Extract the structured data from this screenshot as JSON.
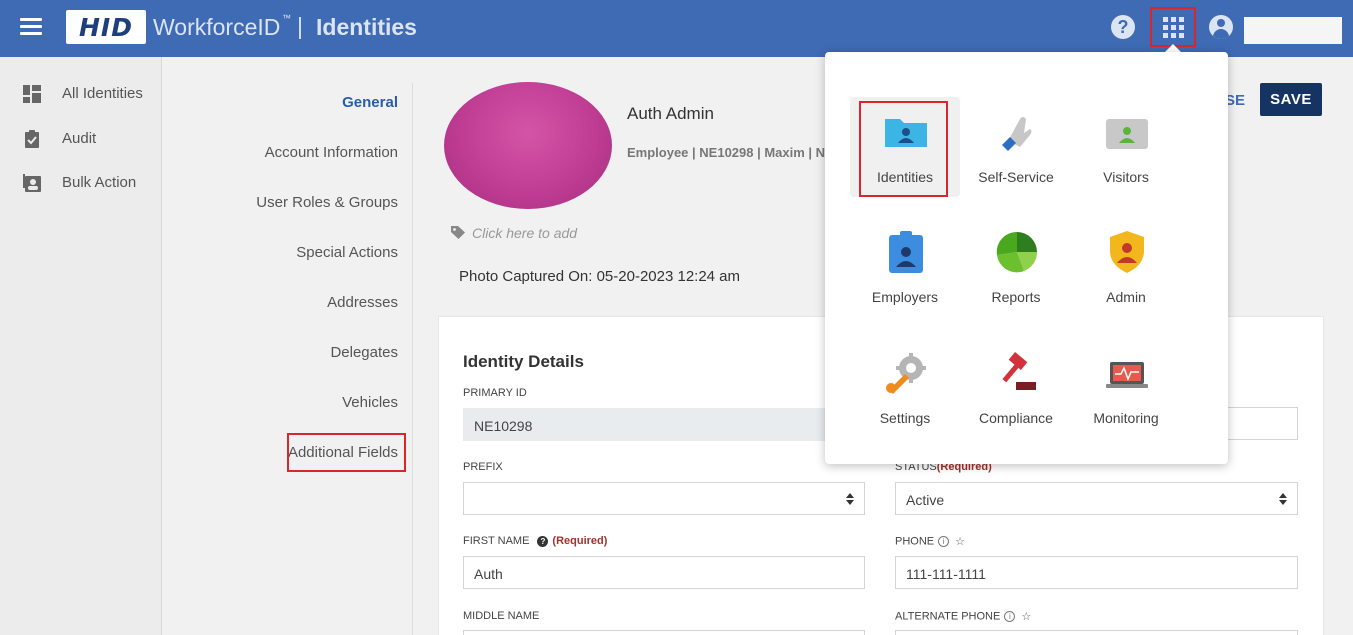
{
  "header": {
    "logo_text": "HID",
    "app_name": "WorkforceID",
    "trademark": "™",
    "separator": "|",
    "section": "Identities",
    "help_symbol": "?",
    "user_name": ""
  },
  "sidebar": {
    "items": [
      {
        "label": "All Identities",
        "icon": "dashboard-icon"
      },
      {
        "label": "Audit",
        "icon": "clipboard-check-icon"
      },
      {
        "label": "Bulk Action",
        "icon": "contact-list-icon"
      }
    ]
  },
  "sections_nav": {
    "items": [
      {
        "label": "General",
        "active": true
      },
      {
        "label": "Account Information",
        "active": false
      },
      {
        "label": "User Roles & Groups",
        "active": false
      },
      {
        "label": "Special Actions",
        "active": false
      },
      {
        "label": "Addresses",
        "active": false
      },
      {
        "label": "Delegates",
        "active": false
      },
      {
        "label": "Vehicles",
        "active": false
      },
      {
        "label": "Additional Fields",
        "active": false
      }
    ]
  },
  "profile": {
    "name": "Auth Admin",
    "meta": "Employee | NE10298 | Maxim | Ne",
    "tag_prompt": "Click here to add",
    "photo_captured": "Photo Captured On: 05-20-2023 12:24 am"
  },
  "actions": {
    "close_label": "SE",
    "save_label": "SAVE"
  },
  "identity_details": {
    "title": "Identity Details",
    "primary_id_label": "PRIMARY ID",
    "primary_id_value": "NE10298",
    "prefix_label": "PREFIX",
    "prefix_value": "",
    "status_label": "STATUS",
    "status_required": "(Required)",
    "status_value": "Active",
    "first_name_label": "FIRST NAME",
    "first_name_required": "(Required)",
    "first_name_value": "Auth",
    "phone_label": "PHONE",
    "phone_value": "111-111-1111",
    "middle_name_label": "MIDDLE NAME",
    "alternate_phone_label": "ALTERNATE PHONE"
  },
  "app_launcher": {
    "apps": [
      {
        "label": "Identities",
        "icon": "identities-folder-icon",
        "selected": true
      },
      {
        "label": "Self-Service",
        "icon": "self-service-hand-icon",
        "selected": false
      },
      {
        "label": "Visitors",
        "icon": "visitors-badge-icon",
        "selected": false
      },
      {
        "label": "Employers",
        "icon": "employers-badge-icon",
        "selected": false
      },
      {
        "label": "Reports",
        "icon": "reports-pie-icon",
        "selected": false
      },
      {
        "label": "Admin",
        "icon": "admin-shield-icon",
        "selected": false
      },
      {
        "label": "Settings",
        "icon": "settings-wrench-gear-icon",
        "selected": false
      },
      {
        "label": "Compliance",
        "icon": "compliance-gavel-icon",
        "selected": false
      },
      {
        "label": "Monitoring",
        "icon": "monitoring-laptop-icon",
        "selected": false
      }
    ]
  },
  "colors": {
    "header_bg": "#3f6ab4",
    "highlight_red": "#d9262c",
    "save_bg": "#163463",
    "active_nav": "#2a5ea8",
    "required": "#a2322c"
  }
}
